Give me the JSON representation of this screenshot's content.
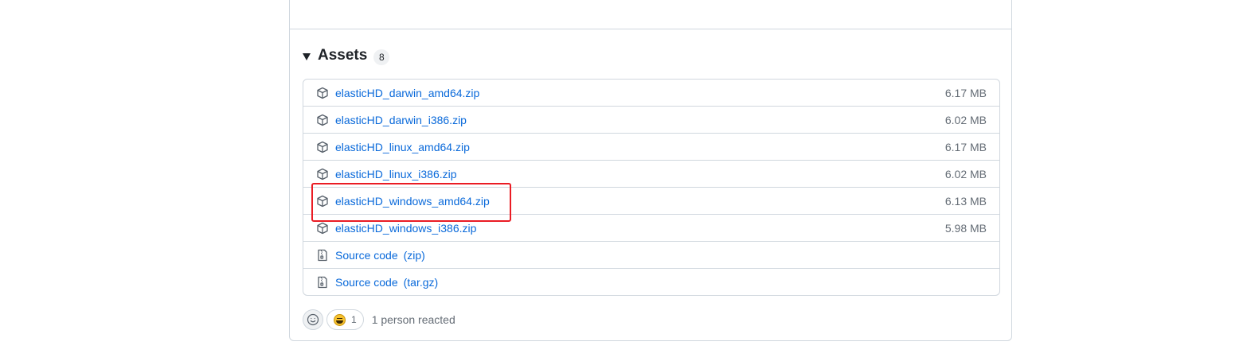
{
  "assets": {
    "title": "Assets",
    "count": "8",
    "items": [
      {
        "name": "elasticHD_darwin_amd64.zip",
        "size": "6.17 MB",
        "icon": "package-icon"
      },
      {
        "name": "elasticHD_darwin_i386.zip",
        "size": "6.02 MB",
        "icon": "package-icon"
      },
      {
        "name": "elasticHD_linux_amd64.zip",
        "size": "6.17 MB",
        "icon": "package-icon"
      },
      {
        "name": "elasticHD_linux_i386.zip",
        "size": "6.02 MB",
        "icon": "package-icon"
      },
      {
        "name": "elasticHD_windows_amd64.zip",
        "size": "6.13 MB",
        "icon": "package-icon"
      },
      {
        "name": "elasticHD_windows_i386.zip",
        "size": "5.98 MB",
        "icon": "package-icon"
      }
    ],
    "sources": [
      {
        "label": "Source code",
        "format": "(zip)",
        "icon": "file-zip-icon"
      },
      {
        "label": "Source code",
        "format": "(tar.gz)",
        "icon": "file-zip-icon"
      }
    ]
  },
  "reactions": {
    "add_icon": "smiley-icon",
    "emoji": "laugh",
    "count": "1",
    "summary": "1 person reacted"
  },
  "colors": {
    "link": "#0969da",
    "muted": "#656d76",
    "border": "#d0d7de",
    "highlight": "#ea1c24"
  }
}
